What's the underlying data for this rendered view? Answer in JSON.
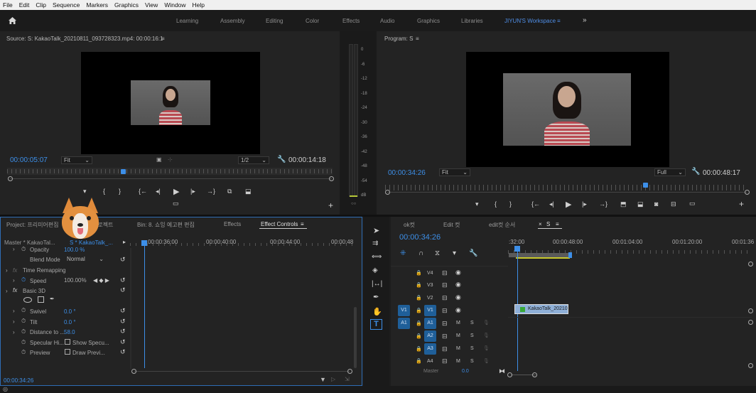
{
  "menu": [
    "File",
    "Edit",
    "Clip",
    "Sequence",
    "Markers",
    "Graphics",
    "View",
    "Window",
    "Help"
  ],
  "workspaces": {
    "home_icon": "home-icon",
    "items": [
      "Learning",
      "Assembly",
      "Editing",
      "Color",
      "Effects",
      "Audio",
      "Graphics",
      "Libraries"
    ],
    "active": "JIYUN'S Workspace",
    "menu_glyph": "≡",
    "more_glyph": "»"
  },
  "source": {
    "title": "Source: S: KakaoTalk_20210811_093728323.mp4: 00:00:16:1",
    "menu_glyph": "≡",
    "timecode": "00:00:05:07",
    "fit": "Fit",
    "zoom": "1/2",
    "duration": "00:00:14:18"
  },
  "meter": {
    "labels": [
      "0",
      "-6",
      "-12",
      "-18",
      "-24",
      "-30",
      "-36",
      "-42",
      "-48",
      "-54",
      "dB"
    ],
    "solo": "S",
    "bottom": "○○"
  },
  "program": {
    "title": "Program: S",
    "menu_glyph": "≡",
    "timecode": "00:00:34:26",
    "fit": "Fit",
    "quality": "Full",
    "duration": "00:00:48:17"
  },
  "transport": {
    "marker": "▾",
    "in": "{",
    "out": "}",
    "go_in": "{←",
    "step_back": "◂|",
    "play": "▶",
    "step_fwd": "|▸",
    "go_out": "→}",
    "plus": "+"
  },
  "effects_panel": {
    "tabs": [
      "Project: 프리미어편집",
      "프로젝트",
      "Bin: 8. 쇼잉 예고편 편집",
      "Effects",
      "Effect Controls"
    ],
    "active_tab": "Effect Controls",
    "master": "Master * KakaoTal...",
    "clip": "S * KakaoTalk_...",
    "ruler": [
      "00:00:36:00",
      "00:00:40:00",
      "00:00:44:00",
      "00:00:48"
    ],
    "rows": {
      "opacity": "Opacity",
      "opacity_val": "100.0 %",
      "blend": "Blend Mode",
      "blend_val": "Normal",
      "time_remap": "Time Remapping",
      "speed": "Speed",
      "speed_val": "100.00%",
      "basic3d": "Basic 3D",
      "swivel": "Swivel",
      "swivel_val": "0.0 °",
      "tilt": "Tilt",
      "tilt_val": "0.0 °",
      "distance": "Distance to ...",
      "distance_val": "58.0",
      "specular": "Specular Hi...",
      "specular_chk": "Show Specu...",
      "preview": "Preview",
      "preview_chk": "Draw Previ..."
    },
    "timecode": "00:00:34:26",
    "fx": "fx"
  },
  "timeline": {
    "tabs": [
      "ok컷",
      "Edit 컷",
      "edit컷 순서",
      "S"
    ],
    "active_tab": "S",
    "timecode": "00:00:34:26",
    "ruler": [
      ":32:00",
      "00:00:48:00",
      "00:01:04:00",
      "00:01:20:00",
      "00:01:36"
    ],
    "video_tracks": [
      "V4",
      "V3",
      "V2",
      "V1"
    ],
    "audio_tracks": [
      "A1",
      "A2",
      "A3",
      "A4"
    ],
    "master": "Master",
    "master_val": "0.0",
    "clip": "KakaoTalk_20210",
    "m": "M",
    "s": "S"
  },
  "colors": {
    "accent": "#3d8fe8",
    "playhead": "#3d8fe8",
    "track_active": "#1f5f99",
    "clip": "#8fb0d8",
    "clip_green": "#38a838",
    "work_area": "#c9c92c"
  }
}
